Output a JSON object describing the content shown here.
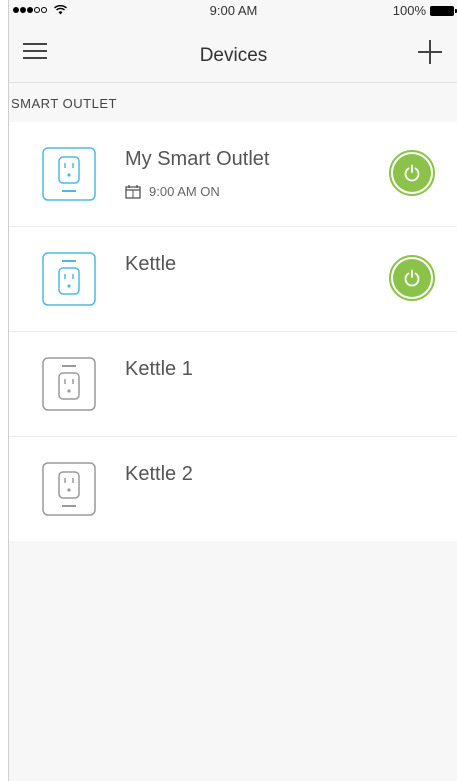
{
  "status_bar": {
    "time": "9:00 AM",
    "battery": "100%"
  },
  "nav": {
    "title": "Devices"
  },
  "section": {
    "header": "SMART OUTLET"
  },
  "devices": [
    {
      "name": "My Smart Outlet",
      "schedule": "9:00 AM ON",
      "active": true,
      "power_on": true
    },
    {
      "name": "Kettle",
      "active": true,
      "power_on": true
    },
    {
      "name": "Kettle 1",
      "active": false
    },
    {
      "name": "Kettle 2",
      "active": false
    }
  ],
  "colors": {
    "active_outline": "#4fb8e6",
    "inactive_outline": "#9a9a9a",
    "power_green": "#8bc34a"
  }
}
